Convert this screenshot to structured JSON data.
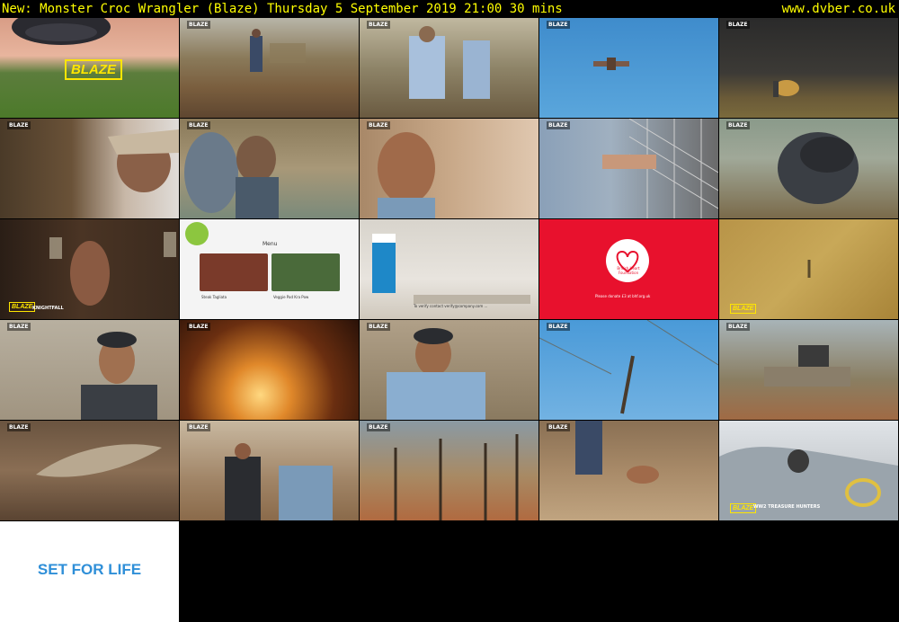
{
  "header": {
    "title": "New: Monster Croc Wrangler (Blaze)    Thursday 5 September 2019  21:00  30 mins",
    "site": "www.dvber.co.uk"
  },
  "overlays": {
    "blaze": "BLAZE",
    "menu": "Menu",
    "meal_1": "Steak Tagliata",
    "meal_2": "Veggie Pad Kra Pow",
    "bhf_name": "British Heart Foundation",
    "bhf_donate": "Please donate £3 at bhf.org.uk",
    "ad_disclaimer": "To verify contact verify@company.com ... ",
    "promo_knightfall": "KNIGHTFALL",
    "promo_ww2": "WW2 TREASURE HUNTERS",
    "set_for_life": "SET FOR LIFE"
  },
  "colors": {
    "header_bg": "#000000",
    "header_text": "#ffff00",
    "blaze_yellow": "#ffe600",
    "bhf_red": "#e8112d",
    "sfl_blue": "#2f8fd8"
  }
}
